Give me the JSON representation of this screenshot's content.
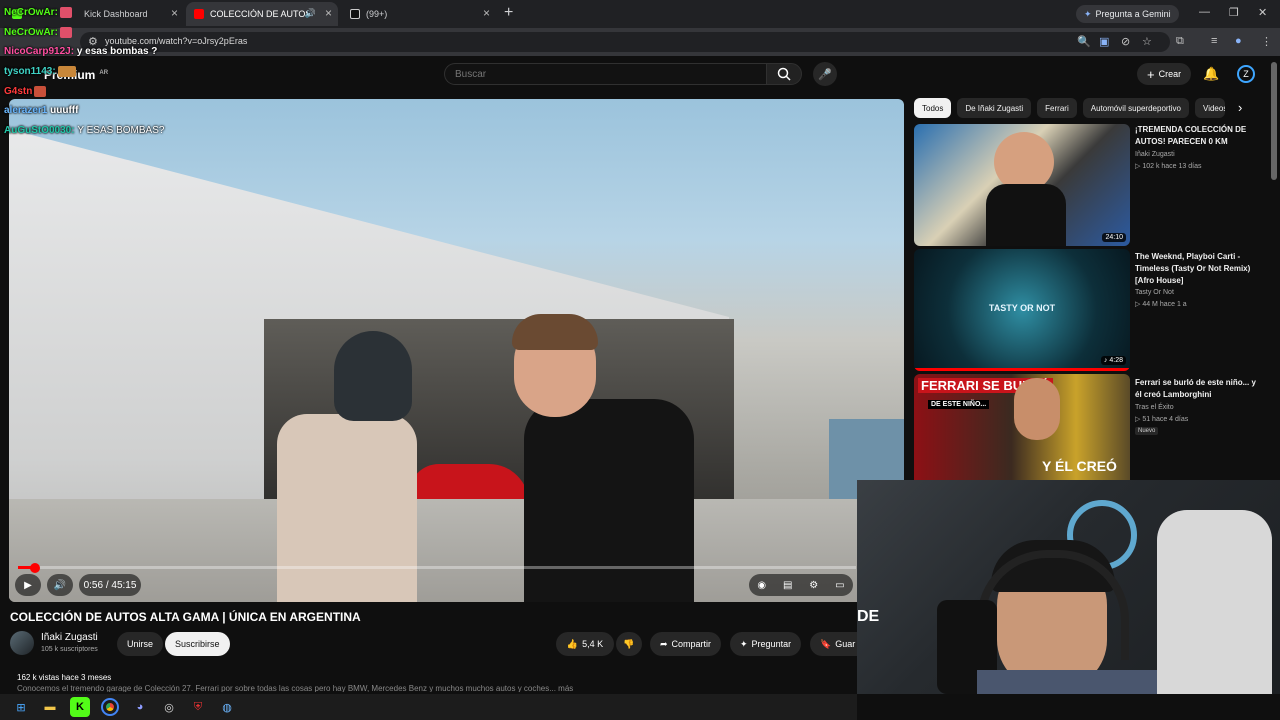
{
  "browser": {
    "tabs": [
      {
        "label": "Kick Dashboard",
        "color": "#53fc18"
      },
      {
        "label": "COLECCIÓN DE AUTOS ALTA",
        "color": "#ff0000"
      },
      {
        "label": "(99+)",
        "color": "#ffffff"
      }
    ],
    "gemini_label": "Pregunta a Gemini",
    "url": "youtube.com/watch?v=oJrsy2pEras"
  },
  "youtube": {
    "logo": "Premium",
    "region": "AR",
    "search_placeholder": "Buscar",
    "create_label": "Crear"
  },
  "video": {
    "time": "0:56 / 45:15",
    "progress": 0.021,
    "title": "COLECCIÓN DE AUTOS ALTA GAMA | ÚNICA EN ARGENTINA",
    "channel": "Iñaki Zugasti",
    "subscribers": "105 k suscriptores",
    "join_label": "Unirse",
    "subscribe_label": "Suscribirse",
    "likes": "5,4 K",
    "share_label": "Compartir",
    "ask_label": "Preguntar",
    "save_label": "Guar",
    "views": "162 k vistas  hace 3 meses",
    "description": "Conocemos el tremendo garage de Colección 27. Ferrari por sobre todas las cosas pero hay BMW, Mercedes Benz y muchos muchos autos y coches... más"
  },
  "chips": [
    "Todos",
    "De Iñaki Zugasti",
    "Ferrari",
    "Automóvil superdeportivo",
    "Videos"
  ],
  "recommendations": [
    {
      "title": "¡TREMENDA COLECCIÓN DE AUTOS! PARECEN 0 KM",
      "channel": "Iñaki Zugasti",
      "meta": "102 k  hace 13 días",
      "duration": "24:10"
    },
    {
      "title": "The Weeknd, Playboi Carti - Timeless (Tasty Or Not Remix) [Afro House]",
      "channel": "Tasty Or Not",
      "meta": "44 M  hace 1 a",
      "duration": "4:28",
      "thumb_text": "TASTY OR NOT"
    },
    {
      "title": "Ferrari se burló de este niño... y él creó Lamborghini",
      "channel": "Tras el Éxito",
      "meta": "51  hace 4 días",
      "badge": "Nuevo",
      "thumb_text_1": "FERRARI SE BURLÓ",
      "thumb_text_2": "DE ESTE NIÑO...",
      "thumb_text_3": "Y ÉL CREÓ"
    }
  ],
  "chat": [
    {
      "user": "NeCrOwAr:",
      "msg": "",
      "color": "#53fc18",
      "emote": "#e0506a"
    },
    {
      "user": "NeCrOwAr:",
      "msg": "",
      "color": "#53fc18",
      "emote": "#e0506a"
    },
    {
      "user": "NicoCarp912J:",
      "msg": "y esas bombas ?",
      "color": "#ff4ea0"
    },
    {
      "user": "tyson1143:",
      "msg": "",
      "color": "#3fd3c6",
      "emote": "#c8873a"
    },
    {
      "user": "G4stn",
      "msg": "",
      "color": "#ff3b3b",
      "emote": "#c8503a"
    },
    {
      "user": "alerazer1",
      "msg": "uuufff",
      "color": "#6ab7ff"
    },
    {
      "user": "AuGuStO0030:",
      "msg": "Y ESAS BOMBAS?",
      "color": "#22c7a9"
    }
  ],
  "webcam": {
    "text": "DE"
  }
}
